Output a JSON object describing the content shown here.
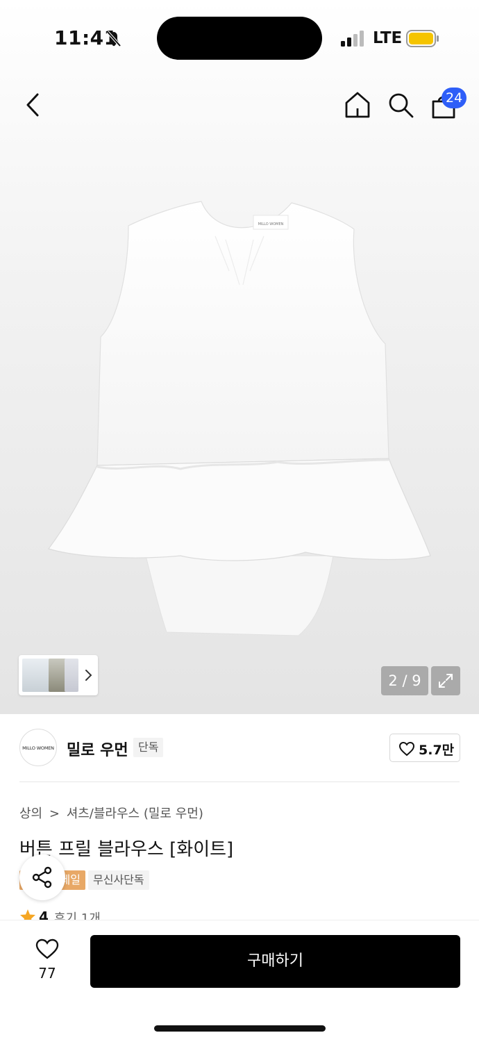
{
  "status_bar": {
    "time": "11:41",
    "network": "LTE",
    "battery_color": "#f5c400",
    "icons": [
      "bell-slash-icon",
      "signal-icon",
      "battery-icon"
    ]
  },
  "nav": {
    "icons": [
      "back-icon",
      "home-icon",
      "search-icon",
      "bag-icon"
    ],
    "bag_count": "24",
    "badge_color": "#2e5ef8"
  },
  "image": {
    "page_counter": "2 / 9",
    "product_image_label": "MILLO WOMEN",
    "thumb_chevron": "chevron-right-icon",
    "expand_icon": "expand-icon"
  },
  "brand": {
    "logo_text": "MILLO WOMEN",
    "name": "밀로 우먼",
    "tag": "단독",
    "likes": "5.7만"
  },
  "breadcrumb": {
    "category": "상의",
    "separator": ">",
    "subcategory": "셔츠/블라우스 (밀로 우먼)"
  },
  "product": {
    "title": "버튼 프릴 블라우스 [화이트]"
  },
  "badges": {
    "sale": "세일",
    "exclusive": "무신사단독",
    "sale_color": "#e8a866"
  },
  "rating": {
    "score": "4",
    "reviews": "후기 1개",
    "star_color": "#f5a623"
  },
  "bottom": {
    "wish_count": "77",
    "buy_label": "구매하기"
  }
}
